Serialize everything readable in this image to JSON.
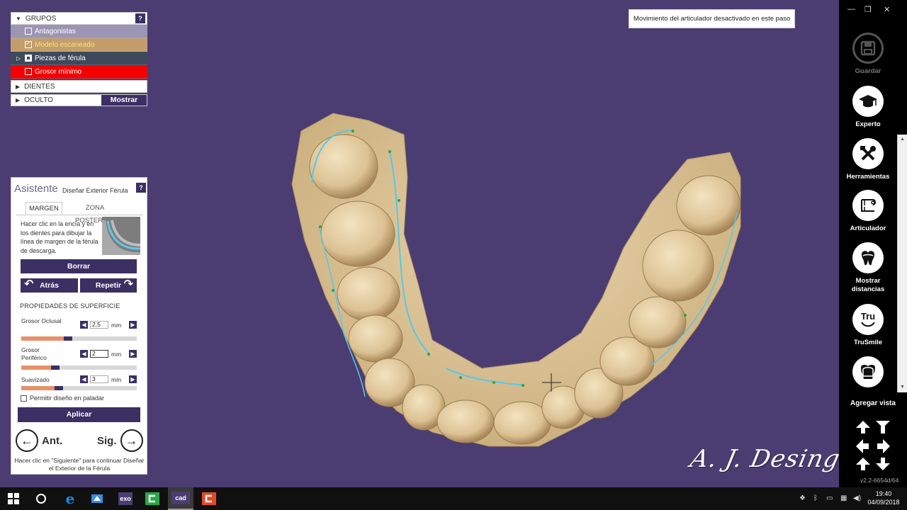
{
  "status_tip": "Movimiento del articulador desactivado en este paso",
  "signature": "A. J. Desing",
  "groups": {
    "header": "GRUPOS",
    "help": "?",
    "items": [
      {
        "label": "Antagonistas",
        "checked": false
      },
      {
        "label": "Modelo escaneado",
        "checked": true
      },
      {
        "label": "Piezas de férula",
        "checked": true
      },
      {
        "label": "Grosor mínimo",
        "checked": false
      }
    ],
    "dientes": "DIENTES",
    "oculto": "OCULTO",
    "mostrar": "Mostrar"
  },
  "wizard": {
    "title": "Asistente",
    "subtitle": "Diseñar Exterior Férula",
    "help": "?",
    "tabs": [
      "MARGEN",
      "ZONA POSTERIOR"
    ],
    "description": "Hacer clic en la encía y en los dientes para dibujar la línea de margen de la férula de descarga.",
    "borrar": "Borrar",
    "atras": "Atrás",
    "repetir": "Repetir",
    "props_title": "PROPIEDADES DE SUPERFICIE",
    "props": [
      {
        "label": "Grosor Oclusal",
        "value": "2,5",
        "unit": "mm",
        "level": 0.37
      },
      {
        "label": "Grosor Periférico",
        "value": "2",
        "unit": "mm",
        "level": 0.26
      },
      {
        "label": "Suavizado",
        "value": "3",
        "unit": "mm",
        "level": 0.29
      }
    ],
    "palate_label": "Permitir diseño en paladar",
    "aplicar": "Aplicar",
    "prev": "Ant.",
    "next": "Sig.",
    "footer": "Hacer clic en \"Siguiente\" para continuar Diseñar el Exterior de la Férula"
  },
  "toolbar": {
    "tools": [
      {
        "label": "Guardar",
        "icon": "save-icon",
        "enabled": false
      },
      {
        "label": "Experto",
        "icon": "graduation-cap-icon",
        "enabled": true
      },
      {
        "label": "Herramientas",
        "icon": "tools-icon",
        "enabled": true
      },
      {
        "label": "Articulador",
        "icon": "articulator-icon",
        "enabled": true
      },
      {
        "label": "Mostrar distancias",
        "icon": "tooth-distance-icon",
        "enabled": true
      },
      {
        "label": "TruSmile",
        "icon": "trusmile-icon",
        "enabled": true
      }
    ],
    "trusmile_glyph": "Tru",
    "add_view": "Agregar vista",
    "version": "v2.2-6654d/64"
  },
  "taskbar": {
    "exo": "exo",
    "cad": "cad",
    "time": "19:40",
    "date": "04/09/2018"
  },
  "colors": {
    "viewport_bg": "#4b3d72",
    "accent": "#3b2f63",
    "model": "#e4cfa4",
    "margin_line": "#56c8e8"
  }
}
